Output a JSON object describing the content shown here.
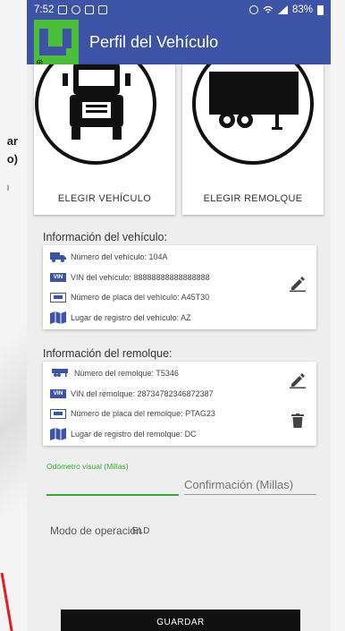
{
  "backdrop": {
    "fragment_1": "ar",
    "fragment_2": "o)",
    "fragment_3": "l"
  },
  "status_bar": {
    "time": "7:52",
    "battery": "83%"
  },
  "app_bar": {
    "title": "Perfil del Vehículo"
  },
  "cards": {
    "vehicle_label": "ELEGIR VEHÍCULO",
    "trailer_label": "ELEGIR REMOLQUE"
  },
  "vehicle_info": {
    "title": "Información del vehículo:",
    "rows": [
      {
        "icon": "truck-icon",
        "text": "Número del vehículo: 104A"
      },
      {
        "icon": "vin-icon",
        "text": "VIN del vehículo: 88888888888888888"
      },
      {
        "icon": "plate-icon",
        "text": "Número de placa del vehículo: A45T30"
      },
      {
        "icon": "map-icon",
        "text": "Lugar de registro del vehículo: AZ"
      }
    ]
  },
  "trailer_info": {
    "title": "Información del remolque:",
    "rows": [
      {
        "icon": "trailer-icon",
        "text": "Número del remolque: T5346"
      },
      {
        "icon": "vin-icon",
        "text": "VIN del remolque: 28734782346872387"
      },
      {
        "icon": "plate-icon",
        "text": "Número de placa del remolque: PTAG23"
      },
      {
        "icon": "map-icon",
        "text": "Lugar de registro del remolque: DC"
      }
    ]
  },
  "odometer": {
    "label": "Odómetro visual (Millas)",
    "value": ""
  },
  "confirmation": {
    "placeholder": "Confirmación (Millas)"
  },
  "operation_mode": {
    "label": "Modo de operación",
    "value": "ELD"
  },
  "save_button": {
    "label": "GUARDAR"
  },
  "vin_badge": "VIN",
  "colors": {
    "primary": "#3d53a6",
    "accent": "#4bbf3a",
    "odometer_green": "#3aa63a"
  }
}
